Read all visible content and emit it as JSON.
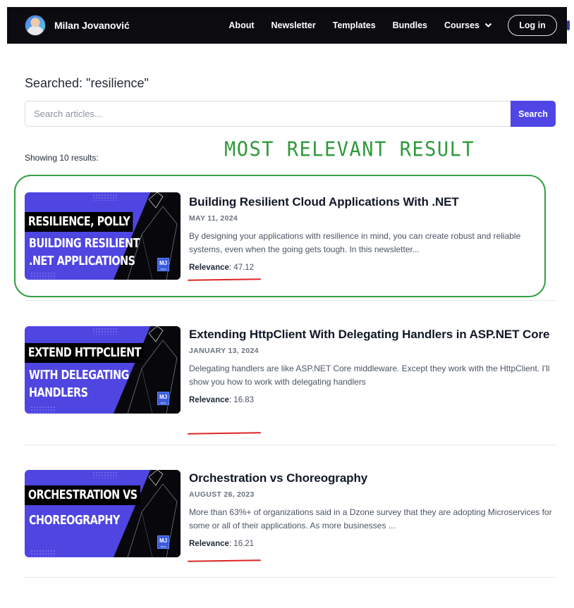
{
  "navbar": {
    "brand_name": "Milan Jovanović",
    "links": [
      "About",
      "Newsletter",
      "Templates",
      "Bundles"
    ],
    "courses_label": "Courses",
    "login_label": "Log in"
  },
  "search": {
    "heading": "Searched: \"resilience\"",
    "placeholder": "Search articles...",
    "value": "",
    "button_label": "Search"
  },
  "results_count": "Showing 10 results:",
  "annotation": {
    "text": "MOST RELEVANT RESULT",
    "color": "#2e9a3a"
  },
  "results": [
    {
      "thumbnail": {
        "line1": "RESILIENCE, POLLY",
        "line2": "BUILDING RESILIENT",
        "line3": ".NET APPLICATIONS",
        "logo": "MJ"
      },
      "title": "Building Resilient Cloud Applications With .NET",
      "date": "MAY 11, 2024",
      "excerpt": "By designing your applications with resilience in mind, you can create robust and reliable systems, even when the going gets tough. In this newsletter...",
      "relevance_label": "Relevance",
      "relevance_value": "47.12"
    },
    {
      "thumbnail": {
        "line1": "EXTEND HTTPCLIENT",
        "line2": "WITH DELEGATING",
        "line3": "HANDLERS",
        "logo": "MJ"
      },
      "title": "Extending HttpClient With Delegating Handlers in ASP.NET Core",
      "date": "JANUARY 13, 2024",
      "excerpt": "Delegating handlers are like ASP.NET Core middleware. Except they work with the HttpClient. I'll show you how to work with delegating handlers",
      "relevance_label": "Relevance",
      "relevance_value": "16.83"
    },
    {
      "thumbnail": {
        "line1": "ORCHESTRATION VS",
        "line2": "CHOREOGRAPHY",
        "line3": "",
        "logo": "MJ"
      },
      "title": "Orchestration vs Choreography",
      "date": "AUGUST 26, 2023",
      "excerpt": "More than 63%+ of organizations said in a Dzone survey that they are adopting Microservices for some or all of their applications. As more businesses ...",
      "relevance_label": "Relevance",
      "relevance_value": "16.21"
    }
  ],
  "colors": {
    "accent": "#4f46e5",
    "navbar_bg": "#0b0b10",
    "highlight_border": "#34a046",
    "underline": "#dc2626"
  }
}
